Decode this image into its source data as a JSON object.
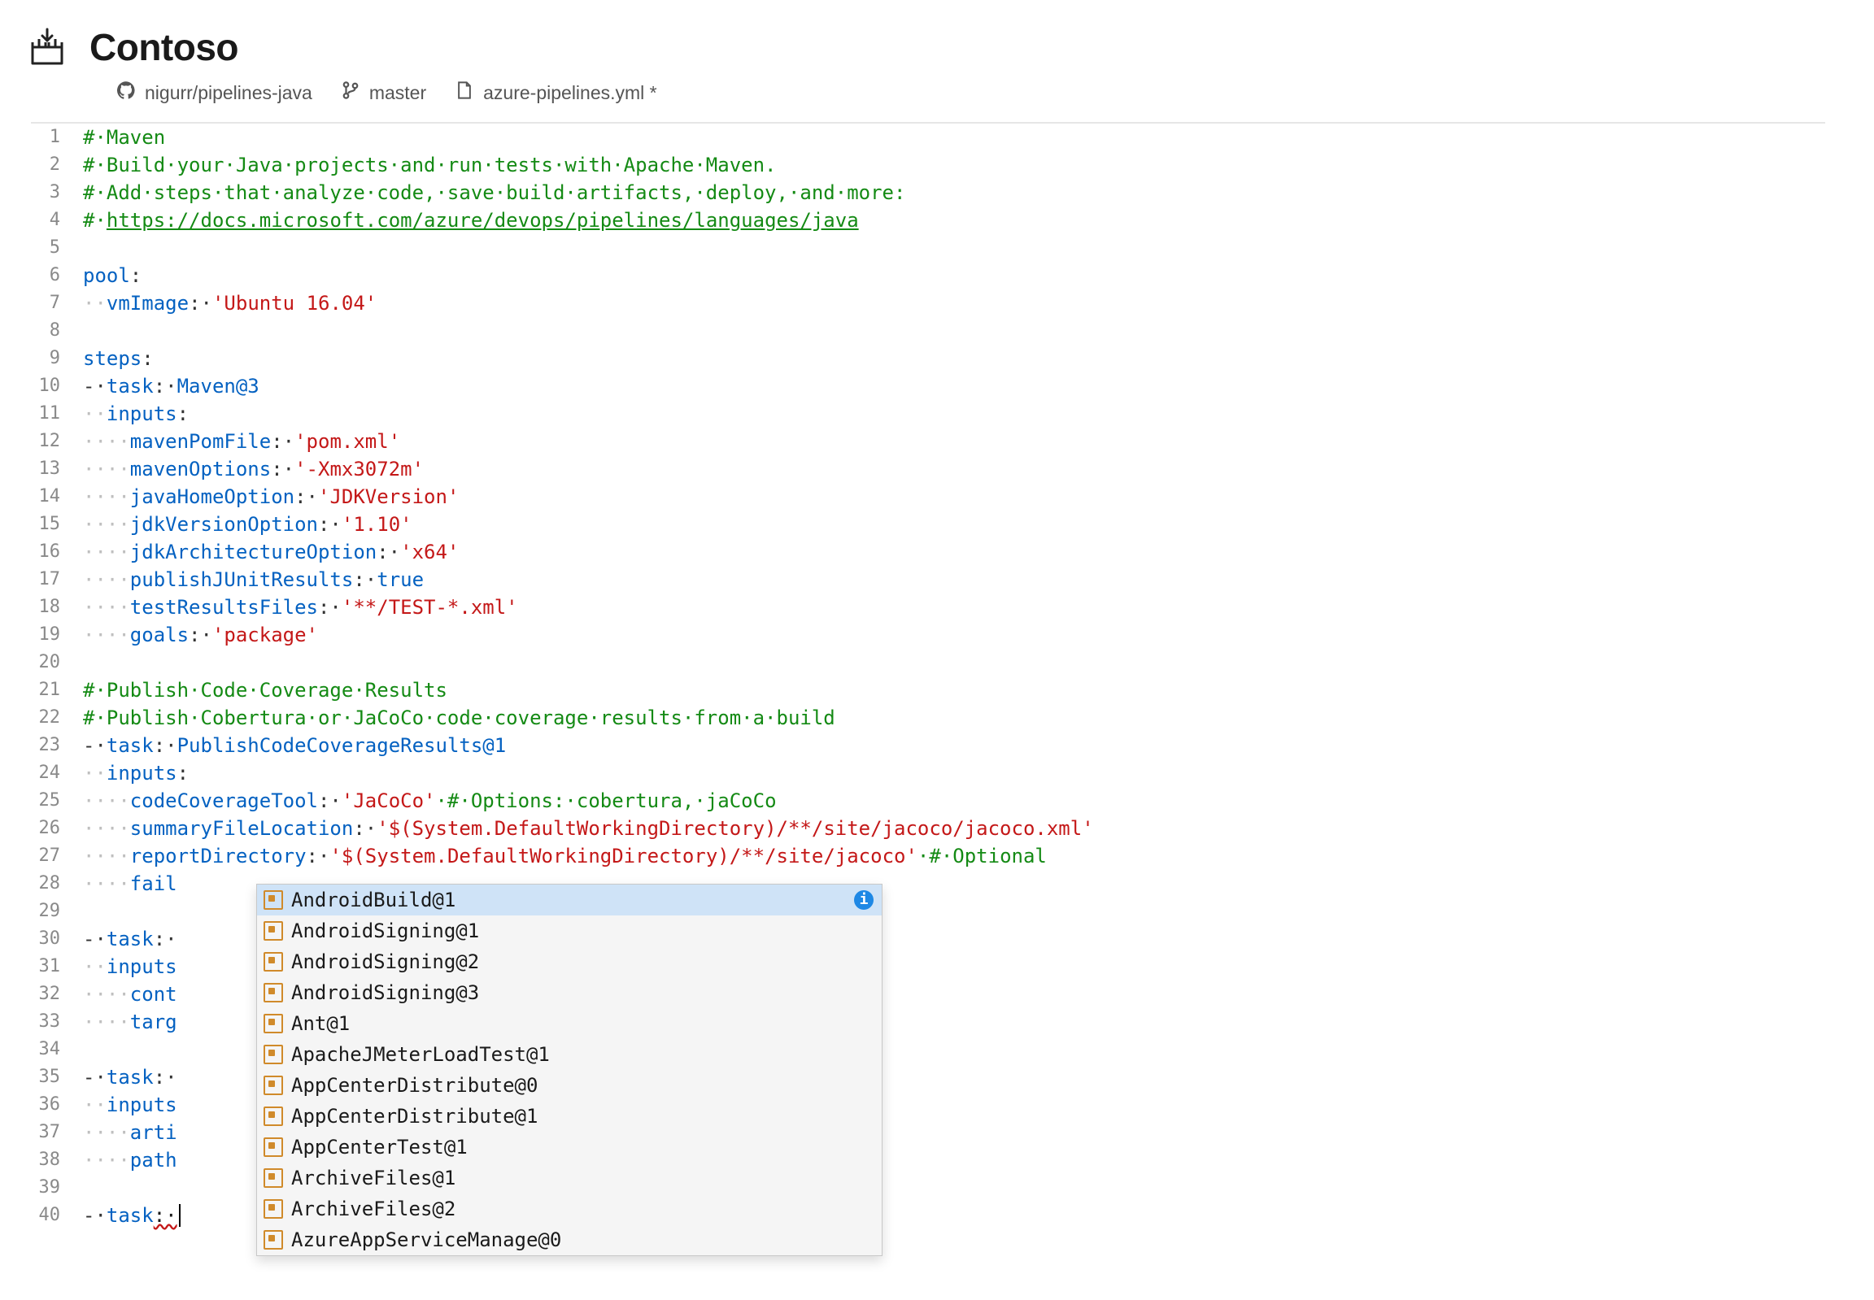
{
  "title": "Contoso",
  "breadcrumb": {
    "repo": "nigurr/pipelines-java",
    "branch": "master",
    "file": "azure-pipelines.yml *"
  },
  "lines": {
    "l1": {
      "comment": "#·Maven"
    },
    "l2": {
      "comment": "#·Build·your·Java·projects·and·run·tests·with·Apache·Maven."
    },
    "l3": {
      "comment": "#·Add·steps·that·analyze·code,·save·build·artifacts,·deploy,·and·more:"
    },
    "l4": {
      "prefix": "#·",
      "link": "https://docs.microsoft.com/azure/devops/pipelines/languages/java"
    },
    "l6": {
      "key": "pool",
      "punct": ":"
    },
    "l7": {
      "indent": "··",
      "key": "vmImage",
      "punct": ":·",
      "string": "'Ubuntu 16.04'"
    },
    "l9": {
      "key": "steps",
      "punct": ":"
    },
    "l10": {
      "dash": "-·",
      "key": "task",
      "punct": ":·",
      "val": "Maven@3"
    },
    "l11": {
      "indent": "··",
      "key": "inputs",
      "punct": ":"
    },
    "l12": {
      "indent": "····",
      "key": "mavenPomFile",
      "punct": ":·",
      "string": "'pom.xml'"
    },
    "l13": {
      "indent": "····",
      "key": "mavenOptions",
      "punct": ":·",
      "string": "'-Xmx3072m'"
    },
    "l14": {
      "indent": "····",
      "key": "javaHomeOption",
      "punct": ":·",
      "string": "'JDKVersion'"
    },
    "l15": {
      "indent": "····",
      "key": "jdkVersionOption",
      "punct": ":·",
      "string": "'1.10'"
    },
    "l16": {
      "indent": "····",
      "key": "jdkArchitectureOption",
      "punct": ":·",
      "string": "'x64'"
    },
    "l17": {
      "indent": "····",
      "key": "publishJUnitResults",
      "punct": ":·",
      "bool": "true"
    },
    "l18": {
      "indent": "····",
      "key": "testResultsFiles",
      "punct": ":·",
      "string": "'**/TEST-*.xml'"
    },
    "l19": {
      "indent": "····",
      "key": "goals",
      "punct": ":·",
      "string": "'package'"
    },
    "l21": {
      "comment": "#·Publish·Code·Coverage·Results"
    },
    "l22": {
      "comment": "#·Publish·Cobertura·or·JaCoCo·code·coverage·results·from·a·build"
    },
    "l23": {
      "dash": "-·",
      "key": "task",
      "punct": ":·",
      "val": "PublishCodeCoverageResults@1"
    },
    "l24": {
      "indent": "··",
      "key": "inputs",
      "punct": ":"
    },
    "l25": {
      "indent": "····",
      "key": "codeCoverageTool",
      "punct": ":·",
      "string": "'JaCoCo'",
      "trail": "·#·Options:·cobertura,·jaCoCo"
    },
    "l26": {
      "indent": "····",
      "key": "summaryFileLocation",
      "punct": ":·",
      "string": "'$(System.DefaultWorkingDirectory)/**/site/jacoco/jacoco.xml'"
    },
    "l27": {
      "indent": "····",
      "key": "reportDirectory",
      "punct": ":·",
      "string": "'$(System.DefaultWorkingDirectory)/**/site/jacoco'",
      "trail": "·#·Optional"
    },
    "l28": {
      "indent": "····",
      "key": "fail"
    },
    "l30": {
      "dash": "-·",
      "key": "task",
      "punct": ":·"
    },
    "l31": {
      "indent": "··",
      "key": "inputs"
    },
    "l32": {
      "indent": "····",
      "key": "cont"
    },
    "l33": {
      "indent": "····",
      "key": "targ"
    },
    "l35": {
      "dash": "-·",
      "key": "task",
      "punct": ":·"
    },
    "l36": {
      "indent": "··",
      "key": "inputs"
    },
    "l37": {
      "indent": "····",
      "key": "arti"
    },
    "l38": {
      "indent": "····",
      "key": "path"
    },
    "l40": {
      "dash": "-·",
      "key": "task",
      "punct": ":·"
    }
  },
  "intellisense": {
    "items": [
      "AndroidBuild@1",
      "AndroidSigning@1",
      "AndroidSigning@2",
      "AndroidSigning@3",
      "Ant@1",
      "ApacheJMeterLoadTest@1",
      "AppCenterDistribute@0",
      "AppCenterDistribute@1",
      "AppCenterTest@1",
      "ArchiveFiles@1",
      "ArchiveFiles@2",
      "AzureAppServiceManage@0"
    ],
    "selectedIndex": 0,
    "infoGlyph": "i"
  },
  "lineNumbers": [
    "1",
    "2",
    "3",
    "4",
    "5",
    "6",
    "7",
    "8",
    "9",
    "10",
    "11",
    "12",
    "13",
    "14",
    "15",
    "16",
    "17",
    "18",
    "19",
    "20",
    "21",
    "22",
    "23",
    "24",
    "25",
    "26",
    "27",
    "28",
    "29",
    "30",
    "31",
    "32",
    "33",
    "34",
    "35",
    "36",
    "37",
    "38",
    "39",
    "40"
  ]
}
